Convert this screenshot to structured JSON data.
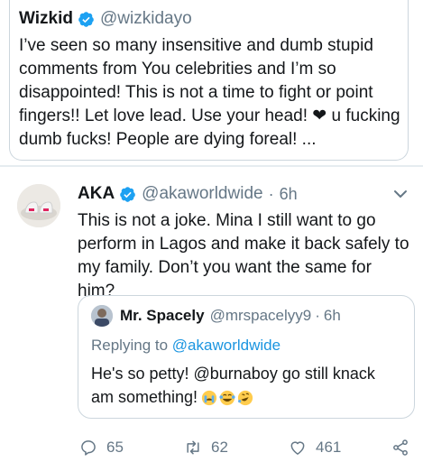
{
  "top_tweet": {
    "name": "Wizkid",
    "handle": "@wizkidayo",
    "text": "I’ve seen so many insensitive and dumb stupid comments from You celebrities and I’m so disappointed! This is not a time to fight or point fingers!! Let love lead. Use your head! ❤ u fucking dumb fucks! People are dying foreal! ..."
  },
  "main_tweet": {
    "name": "AKA",
    "handle": "@akaworldwide",
    "separator": "·",
    "time": "6h",
    "text": "This is not a joke. Mina I still want to go perform in Lagos and make it back safely to my family. Don’t you want the same for him?"
  },
  "quoted_tweet": {
    "name": "Mr. Spacely",
    "handle": "@mrspacelyy9",
    "separator": "·",
    "time": "6h",
    "replying_label": "Replying to",
    "replying_handle": "@akaworldwide",
    "text": "He's so petty! @burnaboy go still knack am something!"
  },
  "actions": {
    "replies": "65",
    "retweets": "62",
    "likes": "461"
  },
  "colors": {
    "accent": "#1da1f2",
    "link": "#1b95e0",
    "muted": "#657786",
    "heart": "#e0245e"
  },
  "icons": [
    "verified-badge-icon",
    "chevron-down-icon",
    "reply-icon",
    "retweet-icon",
    "like-icon",
    "share-icon"
  ]
}
